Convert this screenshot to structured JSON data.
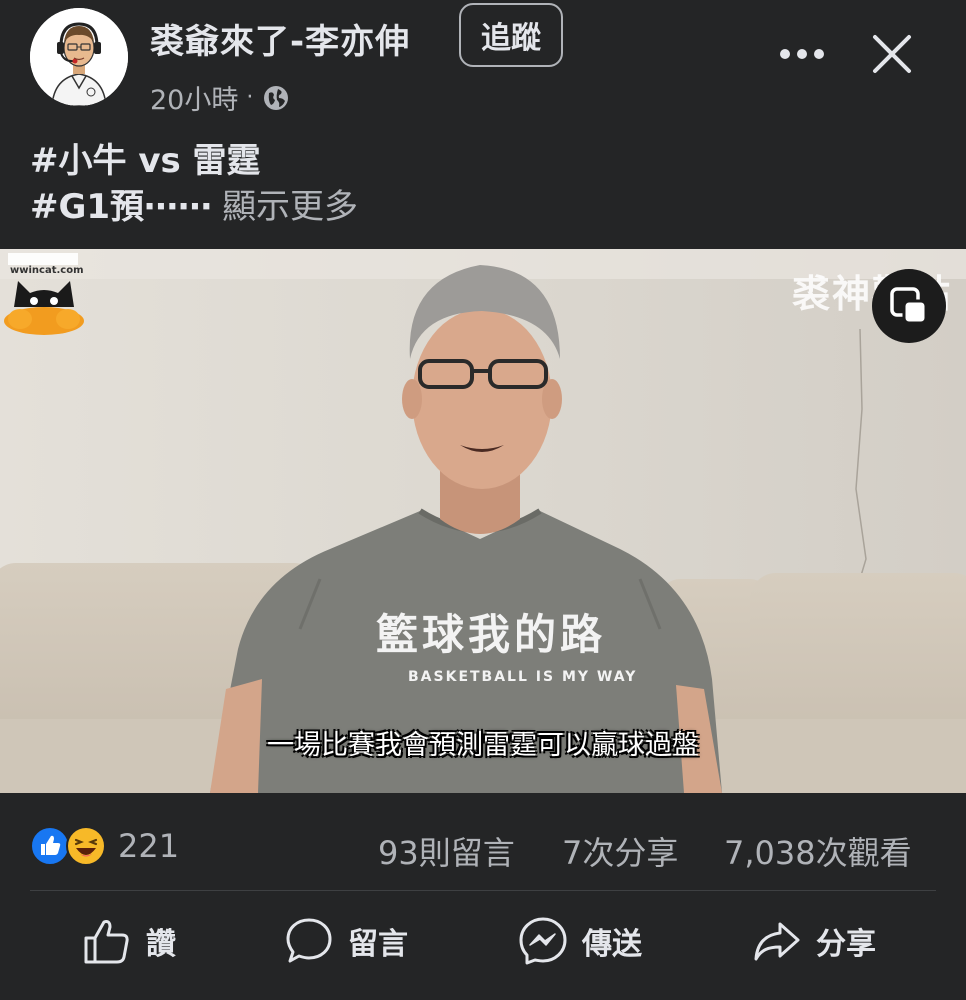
{
  "post": {
    "author_name": "裘爺來了-李亦伸",
    "follow_label": "追蹤",
    "time": "20小時",
    "separator": "·",
    "privacy_icon": "globe-icon",
    "more_icon": "more-icon",
    "close_icon": "close-icon"
  },
  "caption": {
    "line1": "#小牛 vs 雷霆",
    "line2": "#G1預⋯⋯",
    "see_more": "顯示更多"
  },
  "video": {
    "watermark_left_url": "wwincat.com",
    "watermark_right": "裘神觀點",
    "shirt_text": "籃球我的路",
    "shirt_subtext": "BASKETBALL IS MY WAY",
    "subtitle": "一場比賽我會預測雷霆可以贏球過盤",
    "pip_icon": "picture-in-picture-icon"
  },
  "stats": {
    "reactions": [
      "like-icon",
      "haha-icon"
    ],
    "reaction_count": "221",
    "comments": "93則留言",
    "shares": "7次分享",
    "views": "7,038次觀看"
  },
  "actions": {
    "like": "讚",
    "comment": "留言",
    "send": "傳送",
    "share": "分享"
  },
  "colors": {
    "background": "#242526",
    "primary_text": "#e4e6eb",
    "secondary_text": "#b0b3b8",
    "like_blue": "#1877f2",
    "haha_yellow": "#f7b928"
  }
}
